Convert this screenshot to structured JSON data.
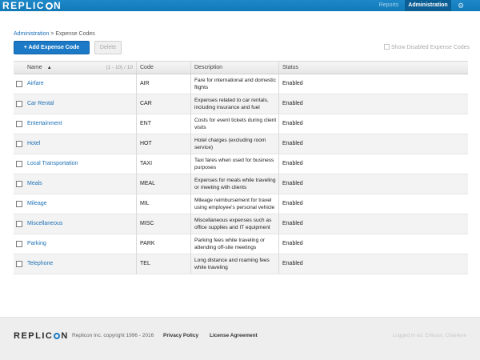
{
  "header": {
    "logo_left": "REPLIC",
    "logo_right": "N",
    "nav": {
      "reports": "Reports",
      "administration": "Administration",
      "settings_icon": "gear-icon"
    }
  },
  "breadcrumb": {
    "parent": "Administration",
    "separator": " > ",
    "current": "Expense Codes"
  },
  "toolbar": {
    "add_label": "+ Add Expense Code",
    "delete_label": "Delete",
    "show_disabled": "Show Disabled Expense Codes"
  },
  "table": {
    "columns": {
      "name": "Name",
      "code": "Code",
      "description": "Description",
      "status": "Status"
    },
    "sort_indicator": "▲",
    "range": "(1 - 10) / 10",
    "rows": [
      {
        "name": "Airfare",
        "code": "AIR",
        "description": "Fare for international and domestic flights",
        "status": "Enabled"
      },
      {
        "name": "Car Rental",
        "code": "CAR",
        "description": "Expenses related to car rentals, including insurance and fuel",
        "status": "Enabled"
      },
      {
        "name": "Entertainment",
        "code": "ENT",
        "description": "Costs for event tickets during client visits",
        "status": "Enabled"
      },
      {
        "name": "Hotel",
        "code": "HOT",
        "description": "Hotel charges (excluding room service)",
        "status": "Enabled"
      },
      {
        "name": "Local Transportation",
        "code": "TAXI",
        "description": "Taxi fares when used for business purposes",
        "status": "Enabled"
      },
      {
        "name": "Meals",
        "code": "MEAL",
        "description": "Expenses for meals while traveling or meeting with clients",
        "status": "Enabled"
      },
      {
        "name": "Mileage",
        "code": "MIL",
        "description": "Mileage reimbursement for travel using employee's personal vehicle",
        "status": "Enabled"
      },
      {
        "name": "Miscellaneous",
        "code": "MISC",
        "description": "Miscellaneous expenses such as office supplies and IT equipment",
        "status": "Enabled"
      },
      {
        "name": "Parking",
        "code": "PARK",
        "description": "Parking fees while traveling or attending off-site meetings",
        "status": "Enabled"
      },
      {
        "name": "Telephone",
        "code": "TEL",
        "description": "Long distance and roaming fees while traveling",
        "status": "Enabled"
      }
    ]
  },
  "footer": {
    "logo_left": "REPLIC",
    "logo_right": "N",
    "copyright": "Replicon Inc. copyright 1996 - 2016",
    "privacy": "Privacy Policy",
    "license": "License Agreement",
    "logged_in": "Logged in as: Erikson, Charlene"
  },
  "colors": {
    "brand_blue": "#1b79c6",
    "header_bar": "#1d88c8",
    "link": "#1b6fb5"
  }
}
